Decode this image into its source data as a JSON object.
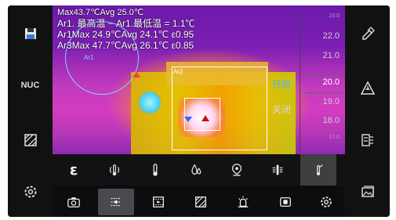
{
  "readout": {
    "line0": "Max43.7℃Avg 25.0℃",
    "line1": "Ar1. 最高温 − Ar1.最低温 = 1.1℃",
    "line2": "Ar1Max 24.9℃Avg 24.1℃ ε0.95",
    "line3": "Ar3Max 47.7℃Avg 26.1℃ ε0.85"
  },
  "area_labels": {
    "ar1": "Ar1",
    "ar2": "Ar2"
  },
  "scale": {
    "ticks": [
      "23.0",
      "22.0",
      "21.0",
      "20.0",
      "19.0",
      "18.0",
      "17.0"
    ],
    "selected": "20.0",
    "on_label": "开启",
    "off_label": "关闭"
  },
  "left_side": [
    "save-icon",
    "NUC",
    "texture-icon",
    "settings-icon"
  ],
  "nuc_label": "NUC",
  "right_side": [
    "edit-icon",
    "warning-icon",
    "palette-edit-icon",
    "gallery-icon"
  ],
  "function_row": [
    "ε",
    "vibration-temp-icon",
    "thermometer-icon",
    "humidity-icon",
    "location-icon",
    "isotherm-icon",
    "thermal-gun-icon"
  ],
  "epsilon": "ε",
  "bottom_row": [
    "camera-icon",
    "thermal-menu-icon",
    "video-icon",
    "texture-icon",
    "alarm-icon",
    "photo-icon",
    "settings-icon"
  ],
  "colors": {
    "accent": "#4fb4ff",
    "background": "#0d0d0f"
  }
}
